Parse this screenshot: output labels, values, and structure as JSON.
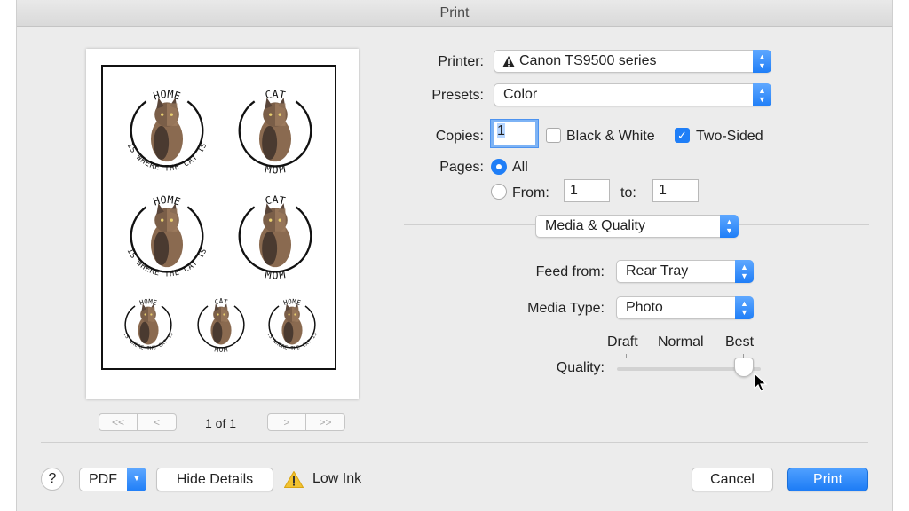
{
  "window": {
    "title": "Print"
  },
  "preview": {
    "stickers": [
      {
        "top": "HOME",
        "bottom": "IS WHERE THE CAT IS"
      },
      {
        "top": "CAT",
        "bottom": "MOM"
      },
      {
        "top": "HOME",
        "bottom": "IS WHERE THE CAT IS"
      },
      {
        "top": "CAT",
        "bottom": "MOM"
      },
      {
        "top": "HOME",
        "bottom": "IS WHERE THE CAT IS"
      },
      {
        "top": "CAT",
        "bottom": "MOM"
      },
      {
        "top": "HOME",
        "bottom": "IS WHERE THE CAT IS"
      }
    ],
    "pager": {
      "first": "<<",
      "prev": "<",
      "label": "1 of 1",
      "next": ">",
      "last": ">>"
    }
  },
  "printer": {
    "label": "Printer:",
    "value": "Canon TS9500 series",
    "status_icon": "warning-triangle-icon"
  },
  "presets": {
    "label": "Presets:",
    "value": "Color"
  },
  "copies": {
    "label": "Copies:",
    "value": "1"
  },
  "black_white": {
    "label": "Black & White",
    "checked": false
  },
  "two_sided": {
    "label": "Two-Sided",
    "checked": true
  },
  "pages": {
    "label": "Pages:",
    "all_label": "All",
    "from_label": "From:",
    "from_value": "1",
    "to_label": "to:",
    "to_value": "1",
    "selected": "All"
  },
  "section": {
    "value": "Media & Quality"
  },
  "feed": {
    "label": "Feed from:",
    "value": "Rear Tray"
  },
  "media_type": {
    "label": "Media Type:",
    "value": "Photo"
  },
  "quality": {
    "label": "Quality:",
    "draft": "Draft",
    "normal": "Normal",
    "best": "Best",
    "level": "Best"
  },
  "footer": {
    "help": "?",
    "pdf": "PDF",
    "hide_details": "Hide Details",
    "low_ink": "Low Ink",
    "cancel": "Cancel",
    "print": "Print"
  },
  "colors": {
    "accent": "#1f7ef7",
    "dialog_bg": "#ececec"
  }
}
